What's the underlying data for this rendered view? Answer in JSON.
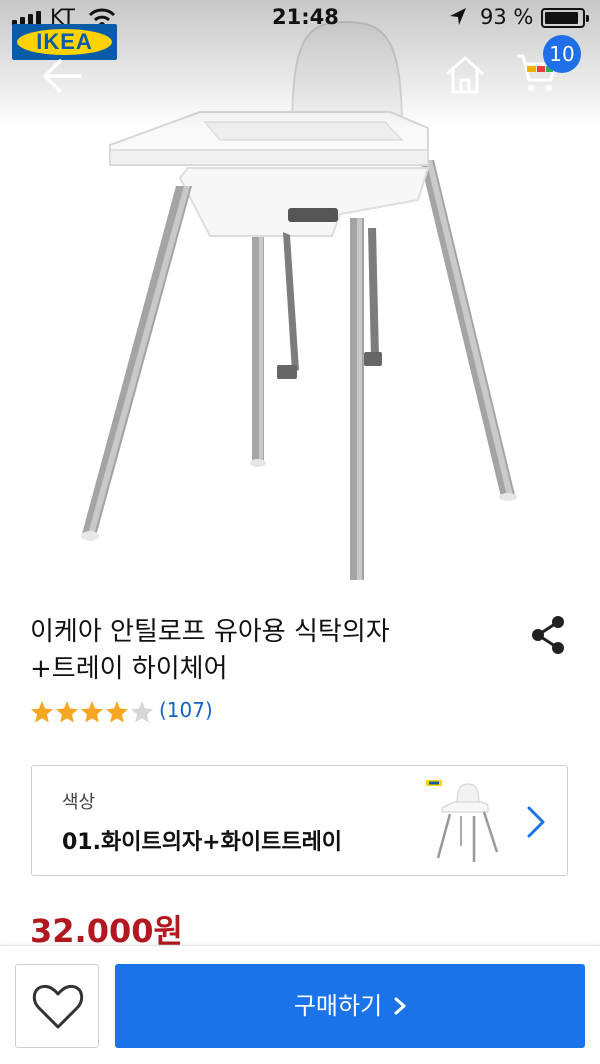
{
  "status_bar": {
    "carrier": "KT",
    "time": "21:48",
    "battery": "93 %",
    "battery_level": 0.93
  },
  "header": {
    "logo_text": "IKEA",
    "cart_count": "10",
    "icons": [
      "back-arrow-icon",
      "home-icon",
      "cart-icon"
    ]
  },
  "product": {
    "title_line1": "이케아 안틸로프 유아용 식탁의자",
    "title_line2": "+트레이 하이체어",
    "rating": 4.5,
    "review_count": "(107)",
    "price": "32.000원"
  },
  "option": {
    "label": "색상",
    "value": "01.화이트의자+화이트트레이"
  },
  "actions": {
    "buy_label": "구매하기",
    "wishlist_icon": "heart-outline-icon"
  },
  "colors": {
    "accent": "#1a73e8",
    "badge": "#1e6fe8",
    "price": "#b3171f",
    "star": "#f5a623",
    "link": "#1565c0"
  }
}
